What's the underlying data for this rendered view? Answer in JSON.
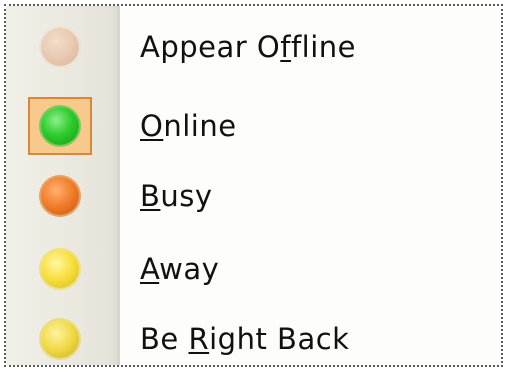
{
  "menu": {
    "items": [
      {
        "id": "appear-offline",
        "pre": "Appear O",
        "accel": "f",
        "post": "fline",
        "icon": "offline-status-icon",
        "color": "#e0b89c",
        "selected": false
      },
      {
        "id": "online",
        "pre": "",
        "accel": "O",
        "post": "nline",
        "icon": "online-status-icon",
        "color": "#2ecc2e",
        "selected": true
      },
      {
        "id": "busy",
        "pre": "",
        "accel": "B",
        "post": "usy",
        "icon": "busy-status-icon",
        "color": "#f07b28",
        "selected": false
      },
      {
        "id": "away",
        "pre": "",
        "accel": "A",
        "post": "way",
        "icon": "away-status-icon",
        "color": "#f6de3c",
        "selected": false
      },
      {
        "id": "be-right-back",
        "pre": "Be ",
        "accel": "R",
        "post": "ight Back",
        "icon": "be-right-back-status-icon",
        "color": "#efd845",
        "selected": false
      }
    ]
  }
}
